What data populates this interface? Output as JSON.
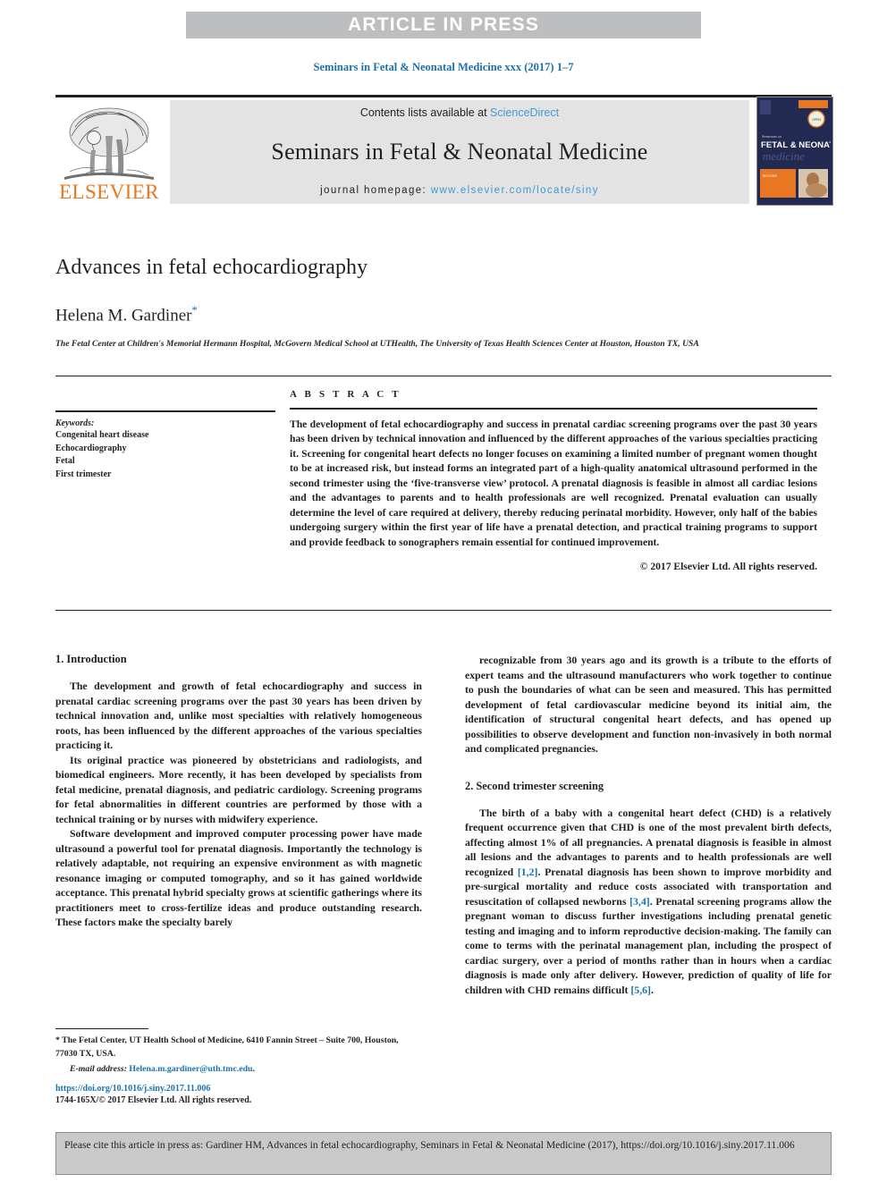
{
  "banner": {
    "label": "ARTICLE IN PRESS"
  },
  "running_head": "Seminars in Fetal & Neonatal Medicine xxx (2017) 1–7",
  "journal_header": {
    "contents_prefix": "Contents lists available at ",
    "sciencedirect": "ScienceDirect",
    "journal_title": "Seminars in Fetal & Neonatal Medicine",
    "homepage_label": "journal homepage: ",
    "homepage_url": "www.elsevier.com/locate/siny",
    "publisher_logo_text": "ELSEVIER",
    "cover": {
      "line1": "Seminars in",
      "line2": "FETAL & NEONATAL",
      "line3": "medicine"
    },
    "colors": {
      "link_blue": "#3f9bd3",
      "elsevier_orange": "#e87722",
      "banner_gray": "#e3e3e3",
      "cover_navy": "#232a52"
    }
  },
  "article": {
    "title": "Advances in fetal echocardiography",
    "author": "Helena M. Gardiner",
    "author_marker": "*",
    "affiliation": "The Fetal Center at Children's Memorial Hermann Hospital, McGovern Medical School at UTHealth, The University of Texas Health Sciences Center at Houston, Houston TX, USA"
  },
  "keywords": {
    "heading": "Keywords:",
    "items": [
      "Congenital heart disease",
      "Echocardiography",
      "Fetal",
      "First trimester"
    ]
  },
  "abstract": {
    "label": "A B S T R A C T",
    "text": "The development of fetal echocardiography and success in prenatal cardiac screening programs over the past 30 years has been driven by technical innovation and influenced by the different approaches of the various specialties practicing it. Screening for congenital heart defects no longer focuses on examining a limited number of pregnant women thought to be at increased risk, but instead forms an integrated part of a high-quality anatomical ultrasound performed in the second trimester using the ‘five-transverse view’ protocol. A prenatal diagnosis is feasible in almost all cardiac lesions and the advantages to parents and to health professionals are well recognized. Prenatal evaluation can usually determine the level of care required at delivery, thereby reducing perinatal morbidity. However, only half of the babies undergoing surgery within the first year of life have a prenatal detection, and practical training programs to support and provide feedback to sonographers remain essential for continued improvement.",
    "copyright": "© 2017 Elsevier Ltd. All rights reserved."
  },
  "sections": {
    "introduction": {
      "heading": "1. Introduction",
      "paragraphs": [
        "The development and growth of fetal echocardiography and success in prenatal cardiac screening programs over the past 30 years has been driven by technical innovation and, unlike most specialties with relatively homogeneous roots, has been influenced by the different approaches of the various specialties practicing it.",
        "Its original practice was pioneered by obstetricians and radiologists, and biomedical engineers. More recently, it has been developed by specialists from fetal medicine, prenatal diagnosis, and pediatric cardiology. Screening programs for fetal abnormalities in different countries are performed by those with a technical training or by nurses with midwifery experience.",
        "Software development and improved computer processing power have made ultrasound a powerful tool for prenatal diagnosis. Importantly the technology is relatively adaptable, not requiring an expensive environment as with magnetic resonance imaging or computed tomography, and so it has gained worldwide acceptance. This prenatal hybrid specialty grows at scientific gatherings where its practitioners meet to cross-fertilize ideas and produce outstanding research. These factors make the specialty barely"
      ],
      "continuation": "recognizable from 30 years ago and its growth is a tribute to the efforts of expert teams and the ultrasound manufacturers who work together to continue to push the boundaries of what can be seen and measured. This has permitted development of fetal cardiovascular medicine beyond its initial aim, the identification of structural congenital heart defects, and has opened up possibilities to observe development and function non-invasively in both normal and complicated pregnancies."
    },
    "second_trimester": {
      "heading": "2. Second trimester screening",
      "paragraph_parts": {
        "p1": "The birth of a baby with a congenital heart defect (CHD) is a relatively frequent occurrence given that CHD is one of the most prevalent birth defects, affecting almost 1% of all pregnancies. A prenatal diagnosis is feasible in almost all lesions and the advantages to parents and to health professionals are well recognized ",
        "cite1": "[1,2]",
        "p2": ". Prenatal diagnosis has been shown to improve morbidity and pre-surgical mortality and reduce costs associated with transportation and resuscitation of collapsed newborns ",
        "cite2": "[3,4]",
        "p3": ". Prenatal screening programs allow the pregnant woman to discuss further investigations including prenatal genetic testing and imaging and to inform reproductive decision-making. The family can come to terms with the perinatal management plan, including the prospect of cardiac surgery, over a period of months rather than in hours when a cardiac diagnosis is made only after delivery. However, prediction of quality of life for children with CHD remains difficult ",
        "cite3": "[5,6]",
        "p4": "."
      }
    }
  },
  "footnote": {
    "marker": "*",
    "address": " The Fetal Center, UT Health School of Medicine, 6410 Fannin Street – Suite 700, Houston, 77030 TX, USA.",
    "email_label": "E-mail address:",
    "email": "Helena.m.gardiner@uth.tmc.edu",
    "email_period": "."
  },
  "doi_block": {
    "doi": "https://doi.org/10.1016/j.siny.2017.11.006",
    "issn_line": "1744-165X/© 2017 Elsevier Ltd. All rights reserved."
  },
  "cite_box": {
    "text": "Please cite this article in press as: Gardiner HM, Advances in fetal echocardiography, Seminars in Fetal & Neonatal Medicine (2017), https://doi.org/10.1016/j.siny.2017.11.006"
  }
}
